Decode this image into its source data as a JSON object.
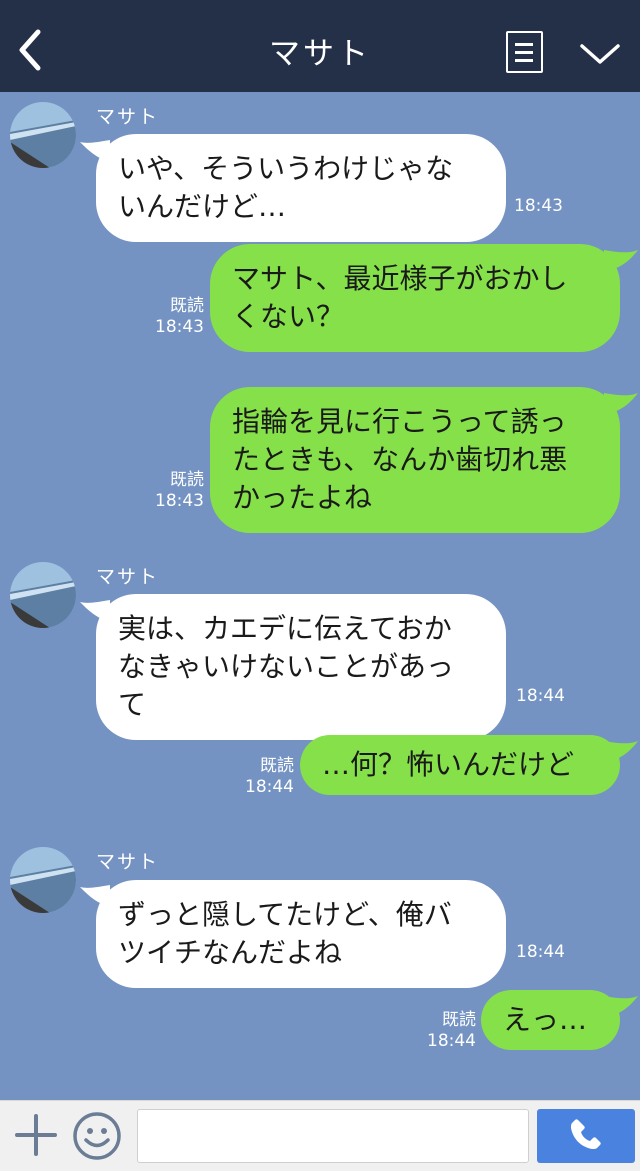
{
  "header": {
    "title": "マサト",
    "back_icon": "chevron-left-icon",
    "menu_icon": "list-icon",
    "collapse_icon": "chevron-down-icon",
    "background": "#242f48"
  },
  "chat": {
    "background": "#7493c2",
    "incoming_bubble_color": "#ffffff",
    "outgoing_bubble_color": "#86e04a",
    "messages": [
      {
        "direction": "in",
        "sender": "マサト",
        "lines": [
          "いや、そういうわけじゃな",
          "いんだけど…"
        ],
        "time": "18:43"
      },
      {
        "direction": "out",
        "read": "既読",
        "lines": [
          "マサト、最近様子がおかし",
          "くない？"
        ],
        "time": "18:43"
      },
      {
        "direction": "out",
        "read": "既読",
        "lines": [
          "指輪を見に行こうって誘っ",
          "たときも、なんか歯切れ悪",
          "かったよね"
        ],
        "time": "18:43"
      },
      {
        "direction": "in",
        "sender": "マサト",
        "lines": [
          "実は、カエデに伝えておか",
          "なきゃいけないことがあっ",
          "て"
        ],
        "time": "18:44"
      },
      {
        "direction": "out",
        "read": "既読",
        "lines": [
          "…何？怖いんだけど"
        ],
        "time": "18:44"
      },
      {
        "direction": "in",
        "sender": "マサト",
        "lines": [
          "ずっと隠してたけど、俺バ",
          "ツイチなんだよね"
        ],
        "time": "18:44"
      },
      {
        "direction": "out",
        "read": "既読",
        "lines": [
          "えっ…"
        ],
        "time": "18:44"
      }
    ]
  },
  "input_bar": {
    "plus_icon": "plus-icon",
    "emoji_icon": "smiley-icon",
    "placeholder": "",
    "value": "",
    "call_icon": "phone-icon",
    "call_color": "#4a82e0"
  }
}
